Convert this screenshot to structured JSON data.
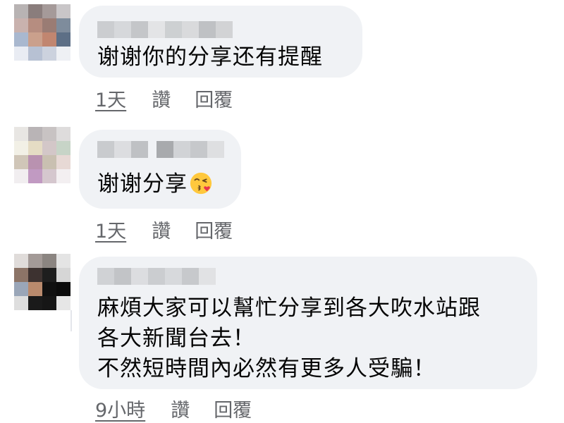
{
  "comments": [
    {
      "body": "谢谢你的分享还有提醒",
      "time": "1天",
      "like": "讚",
      "reply": "回覆"
    },
    {
      "body": "谢谢分享",
      "emoji": "face-blowing-kiss",
      "time": "1天",
      "like": "讚",
      "reply": "回覆"
    },
    {
      "body_lines": [
        "麻煩大家可以幫忙分享到各大吹水站跟",
        "各大新聞台去！",
        "不然短時間內必然有更多人受騙！"
      ],
      "time": "9小時",
      "like": "讚",
      "reply": "回覆"
    }
  ]
}
